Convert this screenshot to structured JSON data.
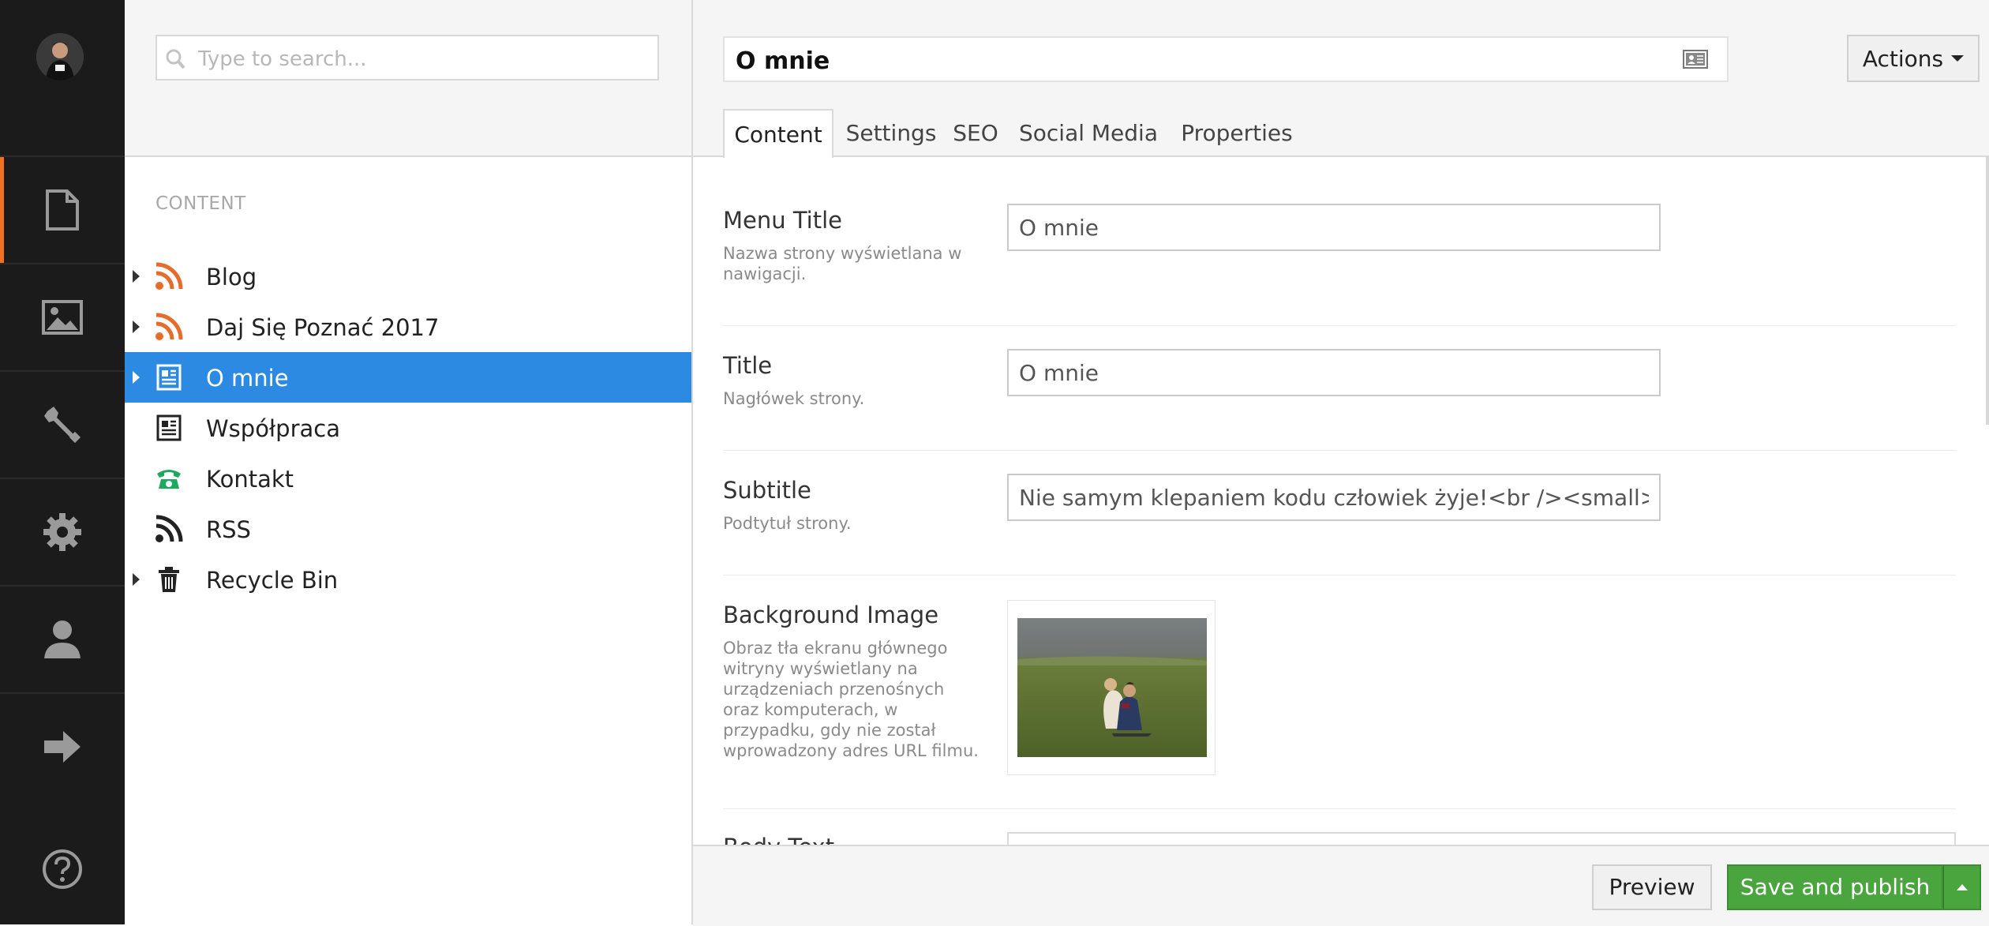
{
  "rail": {
    "items": [
      {
        "name": "content-section",
        "icon": "document-icon",
        "active": true
      },
      {
        "name": "media-section",
        "icon": "image-icon"
      },
      {
        "name": "developer-section",
        "icon": "wrench-icon"
      },
      {
        "name": "settings-section",
        "icon": "gear-icon"
      },
      {
        "name": "users-section",
        "icon": "user-icon"
      },
      {
        "name": "forms-section",
        "icon": "arrow-right-icon"
      },
      {
        "name": "help-section",
        "icon": "help-icon"
      }
    ],
    "accent_color": "#f36f21"
  },
  "tree": {
    "search_placeholder": "Type to search...",
    "section_title": "CONTENT",
    "items": [
      {
        "label": "Blog",
        "icon": "rss-icon",
        "has_children": true,
        "selected": false
      },
      {
        "label": "Daj Się Poznać 2017",
        "icon": "rss-icon",
        "has_children": true,
        "selected": false
      },
      {
        "label": "O mnie",
        "icon": "article-icon",
        "has_children": true,
        "selected": true
      },
      {
        "label": "Współpraca",
        "icon": "article-icon",
        "has_children": false,
        "selected": false
      },
      {
        "label": "Kontakt",
        "icon": "phone-icon",
        "has_children": false,
        "selected": false
      },
      {
        "label": "RSS",
        "icon": "rss-icon",
        "has_children": false,
        "selected": false
      },
      {
        "label": "Recycle Bin",
        "icon": "trash-icon",
        "has_children": true,
        "selected": false
      }
    ],
    "selected_color": "#2d8ae3"
  },
  "editor": {
    "node_name": "O mnie",
    "actions_label": "Actions",
    "tabs": [
      {
        "label": "Content",
        "active": true
      },
      {
        "label": "Settings",
        "active": false
      },
      {
        "label": "SEO",
        "active": false
      },
      {
        "label": "Social Media",
        "active": false
      },
      {
        "label": "Properties",
        "active": false
      }
    ],
    "properties": {
      "menu_title": {
        "label": "Menu Title",
        "description": "Nazwa strony wyświetlana w nawigacji.",
        "value": "O mnie"
      },
      "title": {
        "label": "Title",
        "description": "Nagłówek strony.",
        "value": "O mnie"
      },
      "subtitle": {
        "label": "Subtitle",
        "description": "Podtytuł strony.",
        "value": "Nie samym klepaniem kodu człowiek żyje!<br /><small>(fot. <"
      },
      "background_image": {
        "label": "Background Image",
        "description": "Obraz tła ekranu głównego witryny wyświetlany na urządzeniach przenośnych oraz komputerach, w przypadku, gdy nie został wprowadzony adres URL filmu."
      },
      "body_text": {
        "label": "Body Text"
      }
    }
  },
  "footer": {
    "preview_label": "Preview",
    "publish_label": "Save and publish",
    "publish_color": "#4ba53f"
  }
}
